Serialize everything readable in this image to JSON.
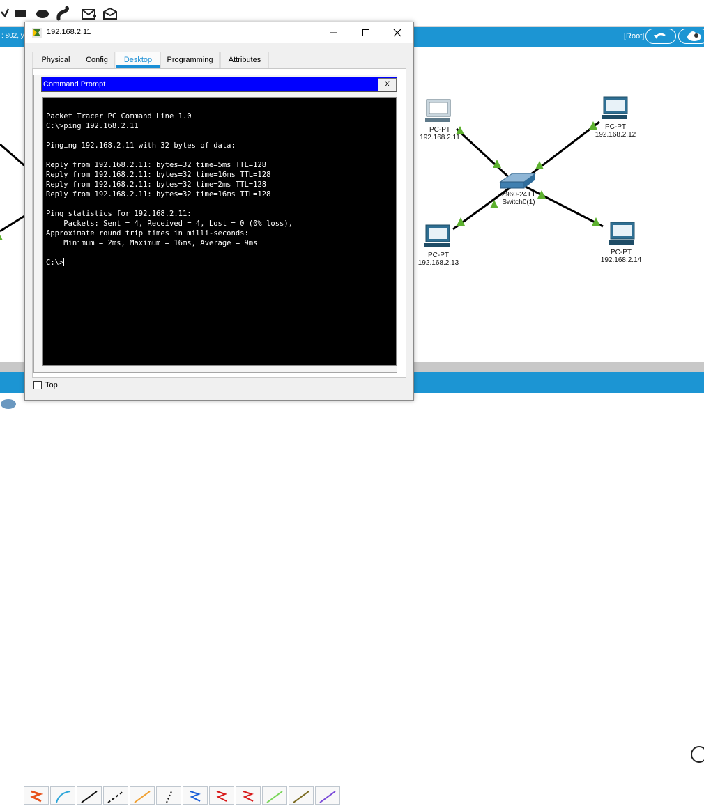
{
  "workspace": {
    "coord_text": ": 802, y",
    "root_label": "[Root]",
    "devices": [
      {
        "type": "PC-PT",
        "ip": "192.168.2.11"
      },
      {
        "type": "PC-PT",
        "ip": "192.168.2.12"
      },
      {
        "type": "PC-PT",
        "ip": "192.168.2.13"
      },
      {
        "type": "PC-PT",
        "ip": "192.168.2.14"
      },
      {
        "type": "2960-24TT",
        "name": "Switch0(1)"
      }
    ]
  },
  "window": {
    "title": "192.168.2.11",
    "tabs": [
      {
        "label": "Physical",
        "active": false
      },
      {
        "label": "Config",
        "active": false
      },
      {
        "label": "Desktop",
        "active": true
      },
      {
        "label": "Programming",
        "active": false
      },
      {
        "label": "Attributes",
        "active": false
      }
    ],
    "command_prompt": {
      "title": "Command Prompt",
      "close_label": "X",
      "output": "Packet Tracer PC Command Line 1.0\nC:\\>ping 192.168.2.11\n\nPinging 192.168.2.11 with 32 bytes of data:\n\nReply from 192.168.2.11: bytes=32 time=5ms TTL=128\nReply from 192.168.2.11: bytes=32 time=16ms TTL=128\nReply from 192.168.2.11: bytes=32 time=2ms TTL=128\nReply from 192.168.2.11: bytes=32 time=16ms TTL=128\n\nPing statistics for 192.168.2.11:\n    Packets: Sent = 4, Received = 4, Lost = 0 (0% loss),\nApproximate round trip times in milli-seconds:\n    Minimum = 2ms, Maximum = 16ms, Average = 9ms\n\n",
      "prompt": "C:\\>"
    },
    "top_checkbox_label": "Top"
  },
  "colors": {
    "accent_blue": "#1c95d3",
    "cmd_header": "#0000ff",
    "link_green": "#5db12f",
    "terminal_bg": "#000000"
  }
}
